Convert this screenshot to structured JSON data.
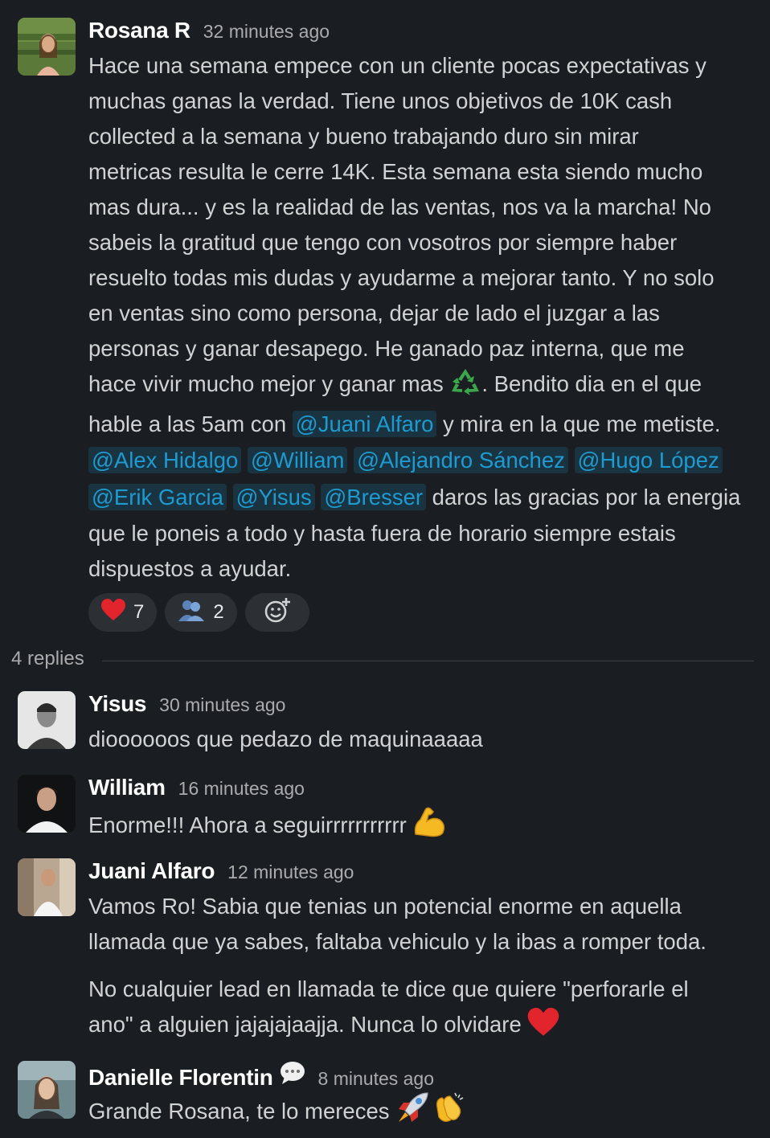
{
  "main_message": {
    "author": "Rosana R",
    "time": "32 minutes ago",
    "lines": {
      "l1": "Hace una semana empece con un cliente pocas expectativas y",
      "l2": "muchas ganas la verdad. Tiene unos objetivos de 10K cash",
      "l3": "collected a la semana y bueno trabajando duro sin mirar",
      "l4": "metricas resulta le cerre 14K. Esta semana esta siendo mucho",
      "l5": "mas dura... y es la realidad de las ventas, nos va la marcha! No",
      "l6": "sabeis la gratitud que tengo con vosotros por siempre haber",
      "l7": "resuelto todas mis dudas y ayudarme a mejorar tanto. Y no solo",
      "l8": "en ventas sino como persona, dejar de lado el juzgar a las",
      "l9": "personas y ganar desapego. He ganado paz interna, que me",
      "l10a": "hace vivir mucho mejor y  ganar mas ",
      "l10b": ". Bendito dia en el que",
      "l11a": "hable a las 5am con ",
      "l11b": " y mira en la que me metiste.",
      "l14a": " daros las gracias por la energia",
      "l15": "que le poneis a todo y hasta fuera de horario siempre estais",
      "l16": "dispuestos a ayudar."
    },
    "mentions": {
      "juani": "@Juani Alfaro",
      "alex": "@Alex Hidalgo",
      "william": "@William",
      "alejandro": "@Alejandro Sánchez",
      "hugo": "@Hugo López",
      "erik": "@Erik Garcia",
      "yisus": "@Yisus",
      "bresser": "@Bresser"
    },
    "inline_emoji": "recycling-symbol",
    "reactions": [
      {
        "emoji": "heart",
        "count": "7"
      },
      {
        "emoji": "busts-in-silhouette",
        "count": "2"
      },
      {
        "emoji": "add-reaction",
        "count": ""
      }
    ]
  },
  "replies_label": "4 replies",
  "replies": [
    {
      "author": "Yisus",
      "time": "30 minutes ago",
      "text": "dioooooos que pedazo de maquinaaaaa"
    },
    {
      "author": "William",
      "time": "16 minutes ago",
      "text": "Enorme!!! Ahora a seguirrrrrrrrrrr ",
      "emoji": "flexed-biceps"
    },
    {
      "author": "Juani Alfaro",
      "time": "12 minutes ago",
      "p1_l1": "Vamos Ro! Sabia que tenias un potencial enorme en aquella",
      "p1_l2": "llamada que ya sabes, faltaba vehiculo y la ibas a romper toda.",
      "p2_l1": "No cualquier lead en llamada te dice que quiere \"perforarle el",
      "p2_l2": "ano\" a alguien jajajajaajja. Nunca lo olvidare ",
      "emoji": "heart"
    },
    {
      "author": "Danielle Florentin",
      "time": "8 minutes ago",
      "text": "Grande Rosana, te lo mereces ",
      "status_emoji": "speech-bubble",
      "emojis": [
        "rocket",
        "clapping-hands"
      ]
    }
  ],
  "colors": {
    "background": "#1a1d21",
    "text": "#d1d2d3",
    "mention": "#1d9bd1",
    "timestamp": "#ababad"
  }
}
